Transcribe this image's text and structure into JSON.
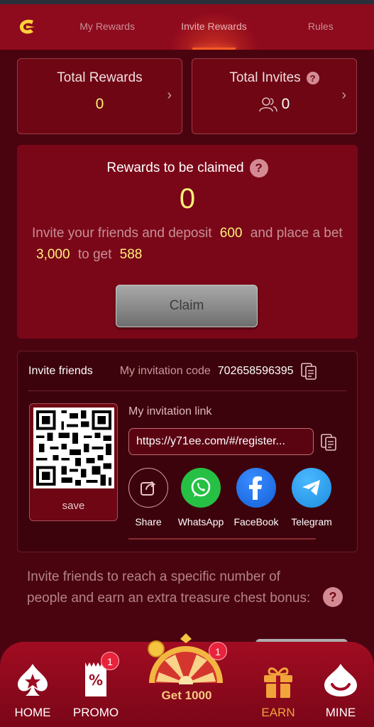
{
  "header": {
    "tabs": [
      {
        "label": "My Rewards",
        "active": false
      },
      {
        "label": "Invite Rewards",
        "active": true
      },
      {
        "label": "Rules",
        "active": false
      }
    ]
  },
  "stats": {
    "total_rewards": {
      "label": "Total Rewards",
      "value": "0"
    },
    "total_invites": {
      "label": "Total Invites",
      "value": "0"
    }
  },
  "claim": {
    "title": "Rewards to be claimed",
    "amount": "0",
    "desc_1": "Invite your friends and deposit",
    "deposit": "600",
    "desc_2": "and place a bet",
    "bet": "3,000",
    "desc_3": "to get",
    "reward": "588",
    "button": "Claim"
  },
  "invite": {
    "title": "Invite friends",
    "code_label": "My invitation code",
    "code": "702658596395",
    "qr_save": "save",
    "link_label": "My invitation link",
    "link": "https://y71ee.com/#/register...",
    "share_items": [
      {
        "label": "Share",
        "icon": "share-icon"
      },
      {
        "label": "WhatsApp",
        "icon": "whatsapp-icon"
      },
      {
        "label": "FaceBook",
        "icon": "facebook-icon"
      },
      {
        "label": "Telegram",
        "icon": "telegram-icon"
      }
    ]
  },
  "bonus": {
    "text": "Invite friends to reach a specific number of people and earn an extra treasure chest bonus:"
  },
  "tabbar": {
    "home": "HOME",
    "promo": "PROMO",
    "promo_badge": "1",
    "wheel": "Get 1000",
    "wheel_badge": "1",
    "earn": "EARN",
    "mine": "MINE"
  },
  "colors": {
    "header": "#8e0a1d",
    "background": "#4a0410",
    "highlight": "#fff07a",
    "accent_orange": "#f0a43a"
  }
}
